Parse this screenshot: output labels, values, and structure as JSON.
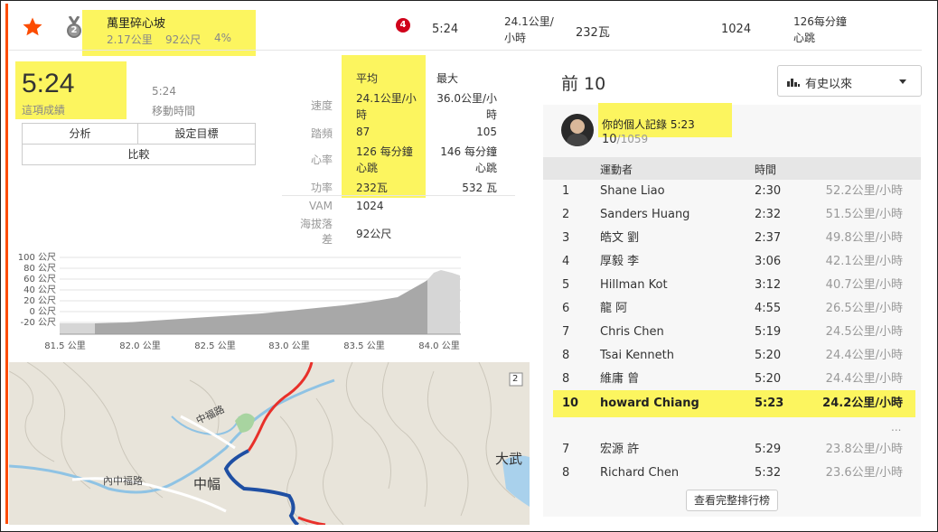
{
  "segment": {
    "name": "萬里碎心坡",
    "distance": "2.17公里",
    "elevation": "92公尺",
    "grade": "4%",
    "badge_count": "4",
    "medal_rank": "2",
    "row_time": "5:24",
    "row_speed": "24.1公里/小時",
    "row_power": "232瓦",
    "row_vam": "1024",
    "row_hr": "126每分鐘心跳"
  },
  "effort": {
    "time": "5:24",
    "time_label": "這項成績",
    "moving_time": "5:24",
    "moving_label": "移動時間",
    "buttons": {
      "analyze": "分析",
      "set_goal": "設定目標",
      "compare": "比較"
    }
  },
  "stats": {
    "col_avg": "平均",
    "col_max": "最大",
    "rows": [
      {
        "label": "速度",
        "avg": "24.1公里/小時",
        "max": "36.0公里/小時"
      },
      {
        "label": "踏頻",
        "avg": "87",
        "max": "105"
      },
      {
        "label": "心率",
        "avg": "126 每分鐘心跳",
        "max": "146 每分鐘心跳"
      },
      {
        "label": "功率",
        "avg": "232瓦",
        "max": "532 瓦"
      },
      {
        "label": "VAM",
        "avg": "1024",
        "max": ""
      },
      {
        "label": "海拔落差",
        "avg": "92公尺",
        "max": ""
      }
    ]
  },
  "elevation_chart": {
    "y_ticks": [
      "100 公尺",
      "80 公尺",
      "60 公尺",
      "40 公尺",
      "20 公尺",
      "0 公尺",
      "-20 公尺"
    ],
    "x_ticks": [
      "81.5 公里",
      "82.0 公里",
      "82.5 公里",
      "83.0 公里",
      "83.5 公里",
      "84.0 公里"
    ]
  },
  "map": {
    "labels": [
      "中福路",
      "內中福路",
      "中幅",
      "大武"
    ],
    "road_badge": "2",
    "colors": {
      "route": "#1f4fa3",
      "road": "#e8302a",
      "water": "#8fc3e4",
      "land": "#e7e2d8"
    }
  },
  "leaderboard": {
    "title": "前 10",
    "filter": "有史以來",
    "pr_label": "你的個人記錄 5:23",
    "pr_rank": "10",
    "pr_total": "/1059",
    "headers": {
      "athlete": "運動者",
      "time": "時間"
    },
    "rows": [
      {
        "rank": "1",
        "name": "Shane Liao",
        "time": "2:30",
        "pace": "52.2公里/小時"
      },
      {
        "rank": "2",
        "name": "Sanders Huang",
        "time": "2:32",
        "pace": "51.5公里/小時"
      },
      {
        "rank": "3",
        "name": "皓文 劉",
        "time": "2:37",
        "pace": "49.8公里/小時"
      },
      {
        "rank": "4",
        "name": "厚毅 李",
        "time": "3:06",
        "pace": "42.1公里/小時"
      },
      {
        "rank": "5",
        "name": "Hillman Kot",
        "time": "3:12",
        "pace": "40.7公里/小時"
      },
      {
        "rank": "6",
        "name": "龍 阿",
        "time": "4:55",
        "pace": "26.5公里/小時"
      },
      {
        "rank": "7",
        "name": "Chris Chen",
        "time": "5:19",
        "pace": "24.5公里/小時"
      },
      {
        "rank": "8",
        "name": "Tsai Kenneth",
        "time": "5:20",
        "pace": "24.4公里/小時"
      },
      {
        "rank": "8",
        "name": "維庸 曾",
        "time": "5:20",
        "pace": "24.4公里/小時"
      }
    ],
    "highlight": {
      "rank": "10",
      "name": "howard Chiang",
      "time": "5:23",
      "pace": "24.2公里/小時"
    },
    "ellipsis": "...",
    "after_rows": [
      {
        "rank": "7",
        "name": "宏源 許",
        "time": "5:29",
        "pace": "23.8公里/小時"
      },
      {
        "rank": "8",
        "name": "Richard Chen",
        "time": "5:32",
        "pace": "23.6公里/小時"
      }
    ],
    "view_full": "查看完整排行榜"
  }
}
